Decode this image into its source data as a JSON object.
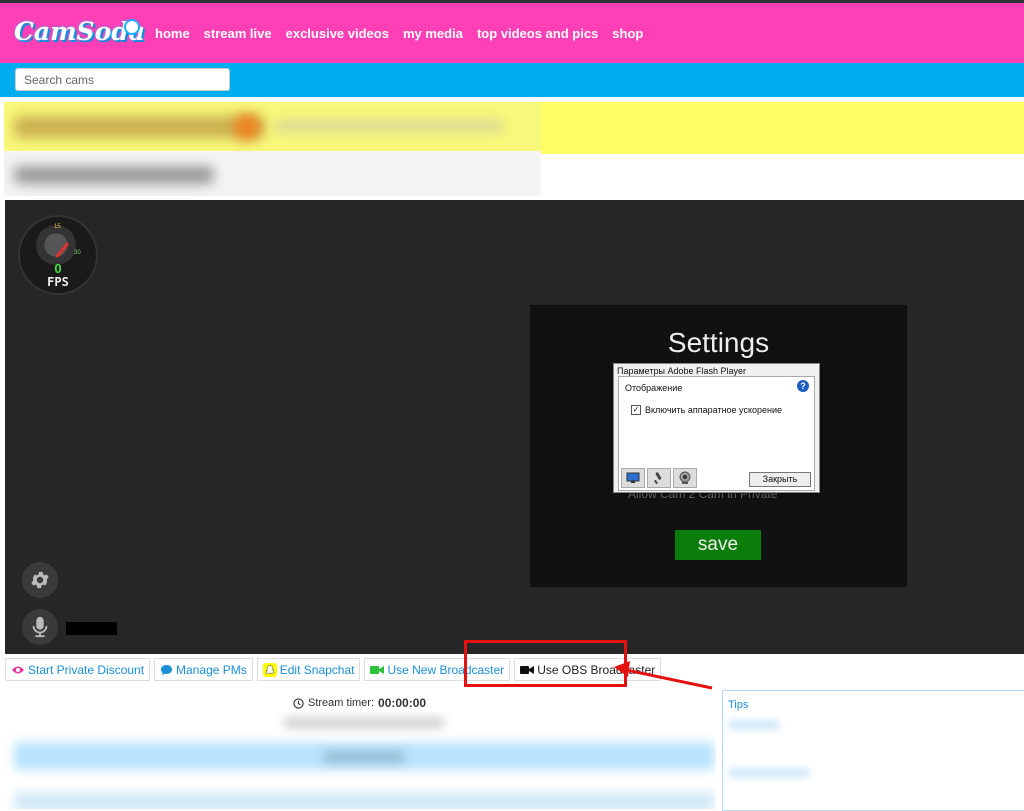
{
  "header": {
    "logo_text": "CamSoda",
    "nav": [
      "home",
      "stream live",
      "exclusive videos",
      "my media",
      "top videos and pics",
      "shop"
    ]
  },
  "search": {
    "placeholder": "Search cams"
  },
  "colors": {
    "header_pink": "#ff3fb6",
    "search_blue": "#00aef0",
    "save_green": "#0a7d0a",
    "highlight_red": "#e51010",
    "link_blue": "#1a8ed8"
  },
  "player": {
    "fps": {
      "value": "0",
      "label": "FPS",
      "tick_low": "15",
      "tick_high": "30"
    },
    "settings": {
      "title": "Settings",
      "hidden_option": "Allow Cam 2 Cam in Private",
      "save_label": "save"
    },
    "flash_dialog": {
      "title": "Параметры Adobe Flash Player",
      "section": "Отображение",
      "help": "?",
      "checkbox_label": "Включить аппаратное ускорение",
      "checkbox_checked": true,
      "close_label": "Закрыть"
    }
  },
  "toolbar": {
    "buttons": [
      {
        "label": "Start Private Discount",
        "icon": "eye-icon"
      },
      {
        "label": "Manage PMs",
        "icon": "chat-bubble-icon"
      },
      {
        "label": "Edit Snapchat",
        "icon": "snapchat-icon"
      },
      {
        "label": "Use New Broadcaster",
        "icon": "video-camera-icon"
      },
      {
        "label": "Use OBS Broadcaster",
        "icon": "video-camera-icon"
      }
    ]
  },
  "stream_timer": {
    "label": "Stream timer:",
    "value": "00:00:00"
  },
  "tips": {
    "label": "Tips"
  }
}
